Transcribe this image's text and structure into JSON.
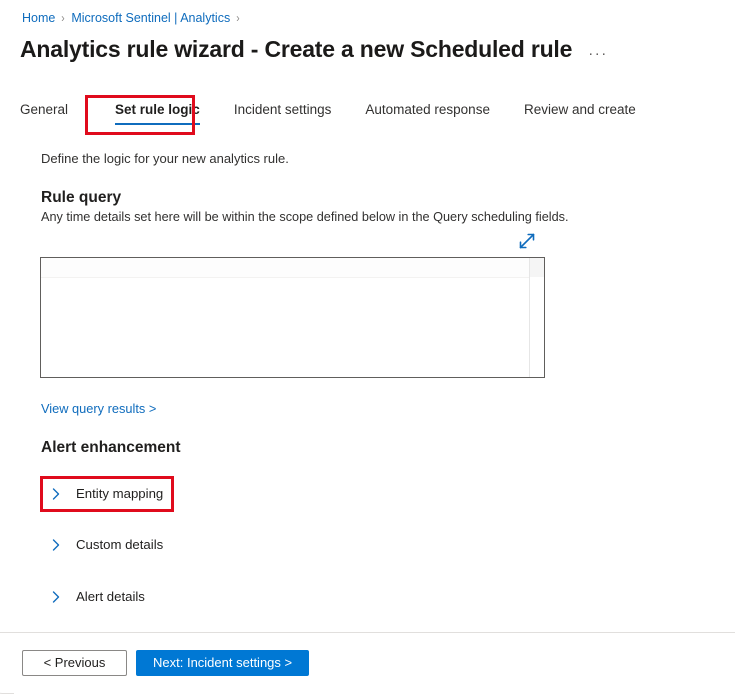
{
  "breadcrumb": {
    "separator": "›",
    "items": [
      {
        "label": "Home"
      },
      {
        "label": "Microsoft Sentinel | Analytics"
      }
    ]
  },
  "header": {
    "title": "Analytics rule wizard - Create a new Scheduled rule",
    "more_menu": "···"
  },
  "tabs": [
    {
      "label": "General",
      "active": false
    },
    {
      "label": "Set rule logic",
      "active": true
    },
    {
      "label": "Incident settings",
      "active": false
    },
    {
      "label": "Automated response",
      "active": false
    },
    {
      "label": "Review and create",
      "active": false
    }
  ],
  "main": {
    "intro": "Define the logic for your new analytics rule.",
    "rule_query": {
      "heading": "Rule query",
      "subtext": "Any time details set here will be within the scope defined below in the Query scheduling fields.",
      "expand_icon": "expand-diagonal-icon",
      "editor_value": "",
      "editor_placeholder": ""
    },
    "view_query_results": "View query results >",
    "alert_enhancement": {
      "heading": "Alert enhancement",
      "sections": [
        {
          "label": "Entity mapping",
          "icon": "chevron-right-icon",
          "expanded": false,
          "highlighted": true
        },
        {
          "label": "Custom details",
          "icon": "chevron-right-icon",
          "expanded": false,
          "highlighted": false
        },
        {
          "label": "Alert details",
          "icon": "chevron-right-icon",
          "expanded": false,
          "highlighted": false
        }
      ]
    }
  },
  "footer": {
    "previous_label": "< Previous",
    "next_label": "Next: Incident settings >"
  },
  "colors": {
    "accent_blue": "#0078d4",
    "link_blue": "#0f6cbd",
    "highlight_red": "#e00b1c",
    "text_primary": "#201f1e",
    "border_gray": "#8a8886"
  }
}
